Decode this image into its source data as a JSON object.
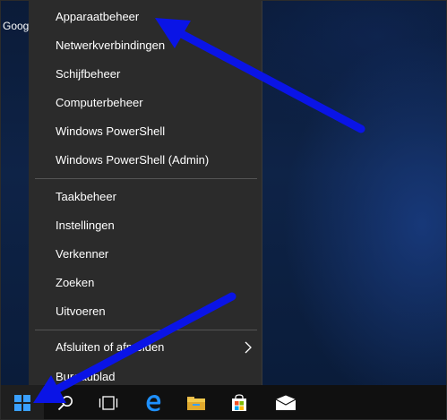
{
  "desktop": {
    "label": "Goog"
  },
  "menu": {
    "group1": [
      {
        "label": "Apparaatbeheer"
      },
      {
        "label": "Netwerkverbindingen"
      },
      {
        "label": "Schijfbeheer"
      },
      {
        "label": "Computerbeheer"
      },
      {
        "label": "Windows PowerShell"
      },
      {
        "label": "Windows PowerShell (Admin)"
      }
    ],
    "group2": [
      {
        "label": "Taakbeheer"
      },
      {
        "label": "Instellingen"
      },
      {
        "label": "Verkenner"
      },
      {
        "label": "Zoeken"
      },
      {
        "label": "Uitvoeren"
      }
    ],
    "group3": [
      {
        "label": "Afsluiten of afmelden",
        "has_submenu": true
      },
      {
        "label": "Bureaublad"
      }
    ]
  },
  "taskbar": {
    "icons": [
      "windows-start-icon",
      "search-icon",
      "task-view-icon",
      "edge-icon",
      "file-explorer-icon",
      "store-icon",
      "mail-icon"
    ]
  },
  "annotations": {
    "arrow_color": "#0a14e6"
  },
  "colors": {
    "menu_bg": "#2b2b2b",
    "taskbar_bg": "#101010",
    "accent": "#1e90ff"
  }
}
